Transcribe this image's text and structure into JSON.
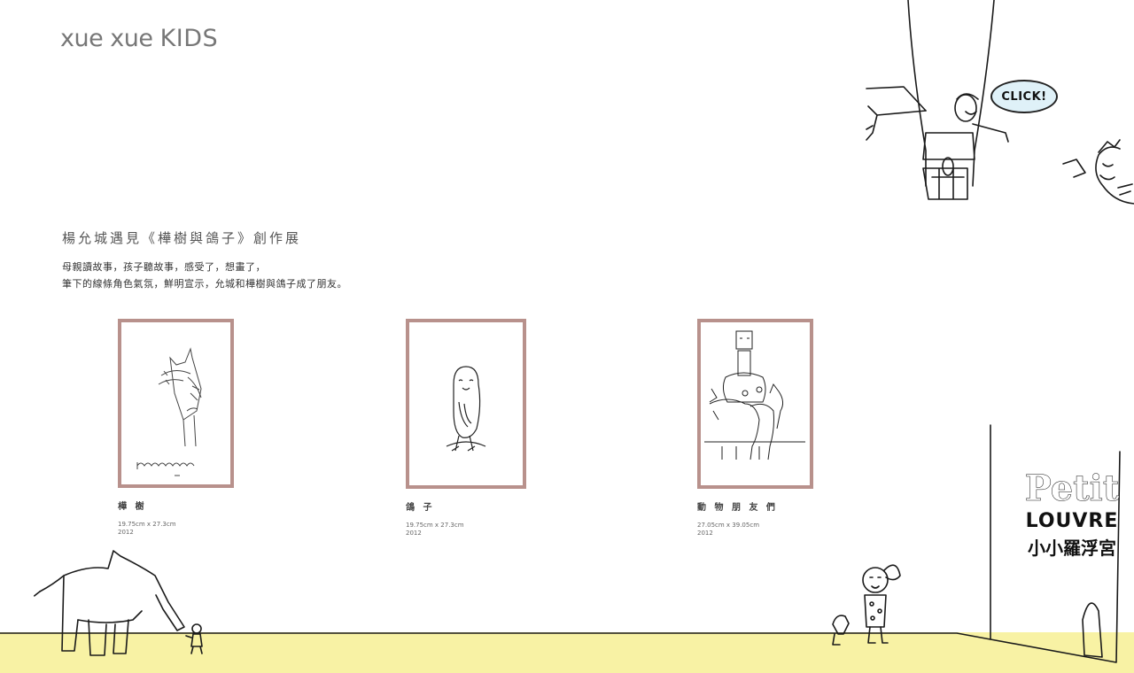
{
  "header": {
    "logo_text": "xue xue",
    "logo_kids": "KIDS"
  },
  "exhibition": {
    "title": "楊允城遇見《樺樹與鴿子》創作展",
    "description_line1": "母親讀故事，孩子聽故事，感受了，想畫了，",
    "description_line2": "筆下的線條角色氣氛，鮮明宣示，允城和樺樹與鴿子成了朋友。"
  },
  "artworks": [
    {
      "title": "樺 樹",
      "size": "19.75cm x 27.3cm",
      "year": "2012"
    },
    {
      "title": "鴿 子",
      "size": "19.75cm x 27.3cm",
      "year": "2012"
    },
    {
      "title": "動 物 朋 友 們",
      "size": "27.05cm x 39.05cm",
      "year": "2012"
    }
  ],
  "click_bubble": {
    "label": "CLICK!"
  },
  "museum_sign": {
    "line1": "Petit",
    "line2": "LOUVRE",
    "line3": "小小羅浮宮"
  },
  "colors": {
    "frame": "#b8918c",
    "ground": "#f8f2a4",
    "bubble": "#dff1f8",
    "logo": "#777777"
  }
}
